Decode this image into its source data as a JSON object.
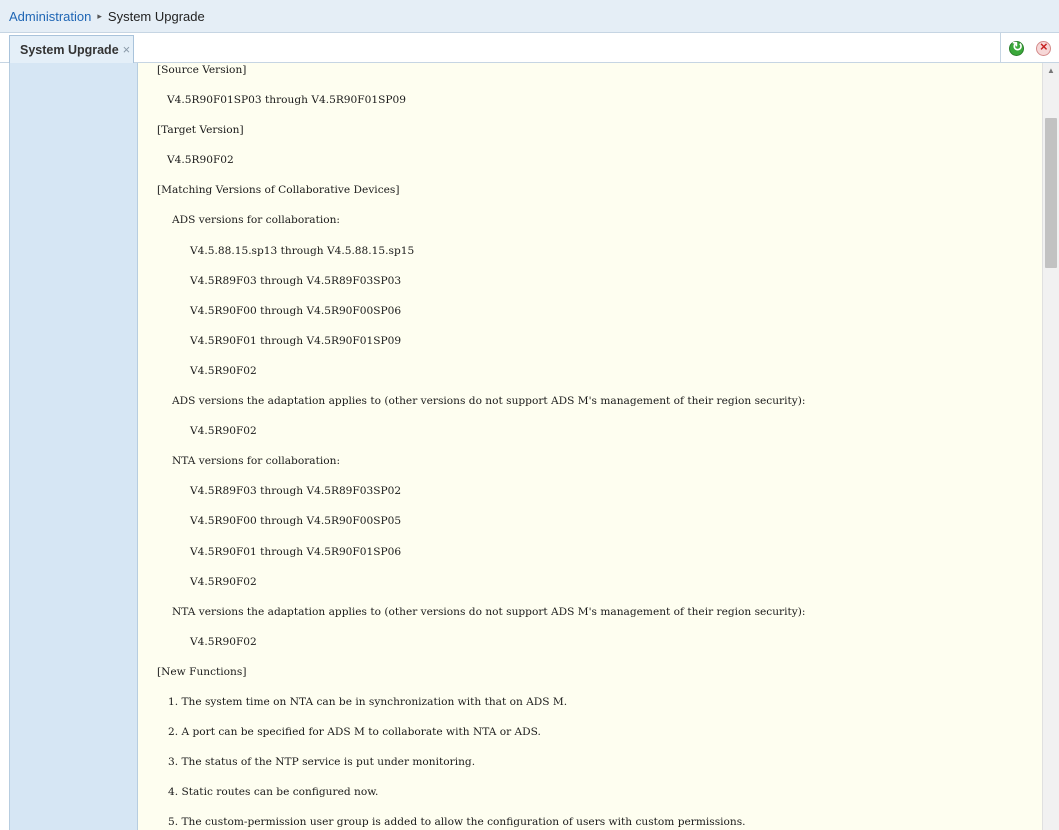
{
  "breadcrumb": {
    "root": "Administration",
    "separator": "▸",
    "current": "System Upgrade"
  },
  "tabs": [
    {
      "label": "System Upgrade",
      "close": "×"
    }
  ],
  "toolbar": {
    "refresh_icon": "refresh-icon",
    "close_all_icon": "close-all-icon"
  },
  "notes": {
    "source_heading": "[Source Version]",
    "source_range": "V4.5R90F01SP03 through V4.5R90F01SP09",
    "target_heading": "[Target Version]",
    "target_version": "V4.5R90F02",
    "matching_heading": "[Matching Versions of Collaborative Devices]",
    "ads_collab_heading": "ADS versions for collaboration:",
    "ads_collab": [
      "V4.5.88.15.sp13 through V4.5.88.15.sp15",
      "V4.5R89F03 through V4.5R89F03SP03",
      "V4.5R90F00 through V4.5R90F00SP06",
      "V4.5R90F01 through V4.5R90F01SP09",
      "V4.5R90F02"
    ],
    "ads_adapt_heading": "ADS versions the adaptation applies to (other versions do not support ADS M's management of their region security):",
    "ads_adapt": [
      "V4.5R90F02"
    ],
    "nta_collab_heading": "NTA versions for collaboration:",
    "nta_collab": [
      "V4.5R89F03 through V4.5R89F03SP02",
      "V4.5R90F00 through V4.5R90F00SP05",
      "V4.5R90F01 through V4.5R90F01SP06",
      "V4.5R90F02"
    ],
    "nta_adapt_heading": "NTA versions the adaptation applies to (other versions do not support ADS M's management of their region security):",
    "nta_adapt": [
      "V4.5R90F02"
    ],
    "new_functions_heading": "[New Functions]",
    "new_functions": [
      "1. The system time on NTA can be in synchronization with that on ADS M.",
      "2. A port can be specified for ADS M to collaborate with NTA or ADS.",
      "3. The status of the NTP service is put under monitoring.",
      "4. Static routes can be configured now.",
      "5. The custom-permission user group is added to allow the configuration of users with custom permissions."
    ]
  },
  "scrollbar": {
    "position_fraction": 0.08
  }
}
